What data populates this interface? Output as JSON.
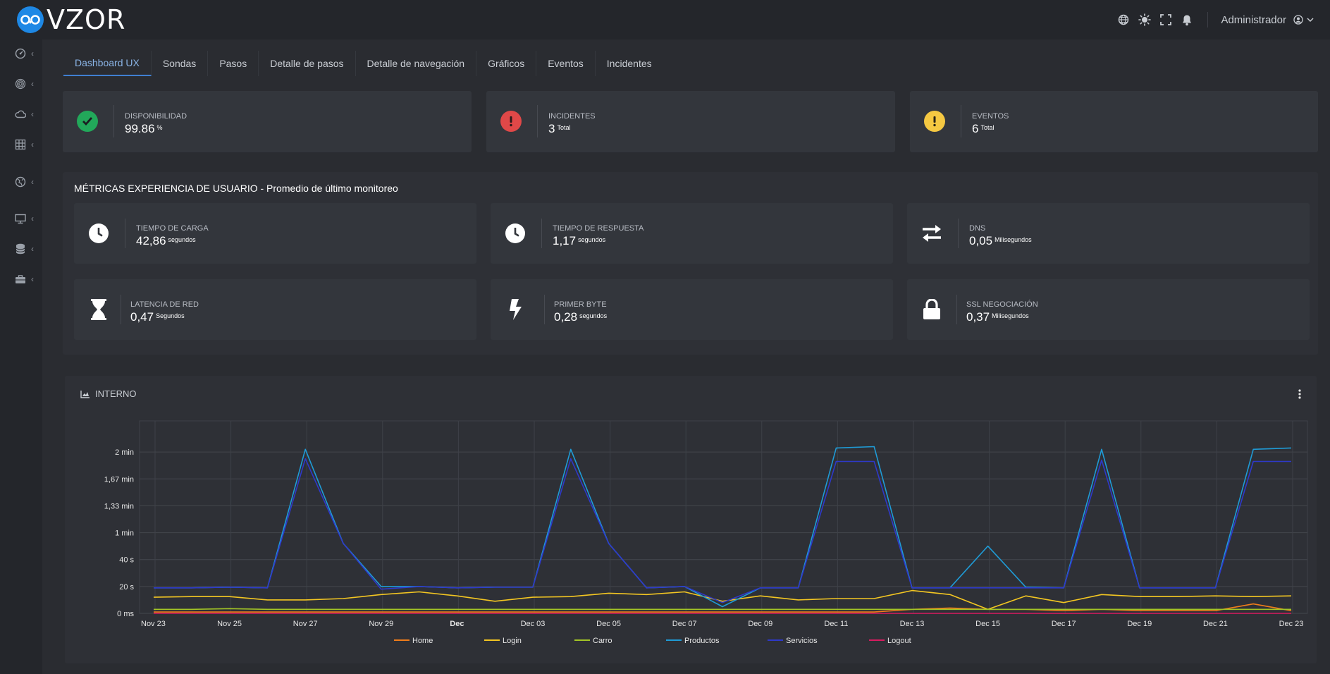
{
  "app": {
    "name": "VZOR"
  },
  "topbar": {
    "icons": [
      "globe-icon",
      "sun-icon",
      "fullscreen-icon",
      "bell-icon"
    ],
    "user": "Administrador"
  },
  "sidebar": {
    "items": [
      {
        "icon": "dashboard-gauge-icon"
      },
      {
        "icon": "fingerprint-icon"
      },
      {
        "icon": "cloud-icon"
      },
      {
        "icon": "grid-icon"
      },
      {
        "icon": "globe-network-icon"
      },
      {
        "icon": "monitor-icon"
      },
      {
        "icon": "database-icon"
      },
      {
        "icon": "toolbox-icon"
      }
    ]
  },
  "tabs": [
    {
      "label": "Dashboard UX",
      "active": true
    },
    {
      "label": "Sondas"
    },
    {
      "label": "Pasos"
    },
    {
      "label": "Detalle de pasos"
    },
    {
      "label": "Detalle de navegación"
    },
    {
      "label": "Gráficos"
    },
    {
      "label": "Eventos"
    },
    {
      "label": "Incidentes"
    }
  ],
  "stats": [
    {
      "label": "Disponibilidad",
      "value": "99.86",
      "unit": "%",
      "color": "#22a85a"
    },
    {
      "label": "Incidentes",
      "value": "3",
      "unit": "Total",
      "color": "#e04848"
    },
    {
      "label": "Eventos",
      "value": "6",
      "unit": "Total",
      "color": "#f5c842"
    }
  ],
  "metrics": {
    "title": "MÉTRICAS EXPERIENCIA DE USUARIO - Promedio de último monitoreo",
    "items": [
      {
        "label": "Tiempo de carga",
        "value": "42,86",
        "unit": "segundos",
        "icon": "clock-icon"
      },
      {
        "label": "Tiempo de respuesta",
        "value": "1,17",
        "unit": "segundos",
        "icon": "clock-icon"
      },
      {
        "label": "DNS",
        "value": "0,05",
        "unit": "Milisegundos",
        "icon": "exchange-arrows-icon"
      },
      {
        "label": "Latencia de red",
        "value": "0,47",
        "unit": "Segundos",
        "icon": "hourglass-icon"
      },
      {
        "label": "Primer byte",
        "value": "0,28",
        "unit": "segundos",
        "icon": "bolt-icon"
      },
      {
        "label": "SSL Negociación",
        "value": "0,37",
        "unit": "Milisegundos",
        "icon": "lock-icon"
      }
    ]
  },
  "chart": {
    "title": "INTERNO"
  },
  "chart_data": {
    "type": "line",
    "title": "INTERNO",
    "x": [
      "Nov 23",
      "Nov 24",
      "Nov 25",
      "Nov 26",
      "Nov 27",
      "Nov 28",
      "Nov 29",
      "Nov 30",
      "Dec 01",
      "Dec 02",
      "Dec 03",
      "Dec 04",
      "Dec 05",
      "Dec 06",
      "Dec 07",
      "Dec 08",
      "Dec 09",
      "Dec 10",
      "Dec 11",
      "Dec 12",
      "Dec 13",
      "Dec 14",
      "Dec 15",
      "Dec 16",
      "Dec 17",
      "Dec 18",
      "Dec 19",
      "Dec 20",
      "Dec 21",
      "Dec 22",
      "Dec 23"
    ],
    "x_tick_labels": [
      "Nov 23",
      "Nov 25",
      "Nov 27",
      "Nov 29",
      "Dec",
      "Dec 03",
      "Dec 05",
      "Dec 07",
      "Dec 09",
      "Dec 11",
      "Dec 13",
      "Dec 15",
      "Dec 17",
      "Dec 19",
      "Dec 21",
      "Dec 23"
    ],
    "y_unit": "seconds",
    "y_tick_labels": [
      "0 ms",
      "20 s",
      "40 s",
      "1 min",
      "1,33 min",
      "1,67 min",
      "2 min"
    ],
    "y_ticks": [
      0,
      20,
      40,
      60,
      80,
      100,
      120
    ],
    "ylim": [
      0,
      140
    ],
    "grid": true,
    "legend_position": "bottom",
    "series": [
      {
        "name": "Home",
        "color": "#f07d1a",
        "values": [
          1,
          1,
          1,
          1,
          1,
          1,
          1,
          1,
          1,
          1,
          1,
          1,
          1,
          1,
          1,
          1,
          1,
          1,
          1,
          1,
          3,
          4,
          3,
          3,
          2,
          3,
          2,
          2,
          2,
          7,
          2
        ]
      },
      {
        "name": "Login",
        "color": "#f3c622",
        "values": [
          12,
          12.5,
          12.5,
          10,
          10,
          11,
          14,
          16,
          13,
          9,
          12,
          12.5,
          15,
          14,
          16,
          9,
          13,
          10,
          11,
          11,
          17,
          14,
          3,
          13,
          8,
          14,
          12.5,
          12.5,
          13,
          12.5,
          13
        ]
      },
      {
        "name": "Carro",
        "color": "#a3c526",
        "values": [
          3,
          3,
          3.5,
          3,
          3,
          3,
          3,
          3,
          3,
          3,
          3,
          3,
          3,
          3,
          3,
          3,
          3,
          3,
          3,
          3,
          3,
          3,
          3,
          3,
          3,
          3,
          3,
          3,
          3,
          3,
          3
        ]
      },
      {
        "name": "Productos",
        "color": "#1f9bd6",
        "values": [
          19,
          19,
          19.5,
          19,
          122,
          52,
          20,
          20,
          19,
          19.5,
          19.5,
          122,
          52,
          19,
          20,
          5,
          19,
          19,
          123,
          124,
          19,
          19,
          50,
          19.5,
          19,
          122,
          19,
          19,
          19,
          122,
          123
        ]
      },
      {
        "name": "Servicios",
        "color": "#2e39c9",
        "values": [
          19,
          19,
          19.5,
          19,
          115,
          52,
          18,
          20,
          19,
          19.5,
          19.5,
          115,
          52,
          19,
          20,
          8,
          19,
          19,
          113,
          113,
          19,
          19,
          19,
          19,
          19,
          114,
          19,
          19,
          19,
          113,
          113
        ]
      },
      {
        "name": "Logout",
        "color": "#d81b60",
        "values": [
          0,
          0,
          0,
          0,
          0,
          0,
          0,
          0,
          0,
          0,
          0,
          0,
          0,
          0,
          0,
          0,
          0,
          0,
          0,
          0,
          0,
          0,
          0,
          0,
          0,
          0,
          0,
          0,
          0,
          0,
          0
        ]
      }
    ]
  }
}
